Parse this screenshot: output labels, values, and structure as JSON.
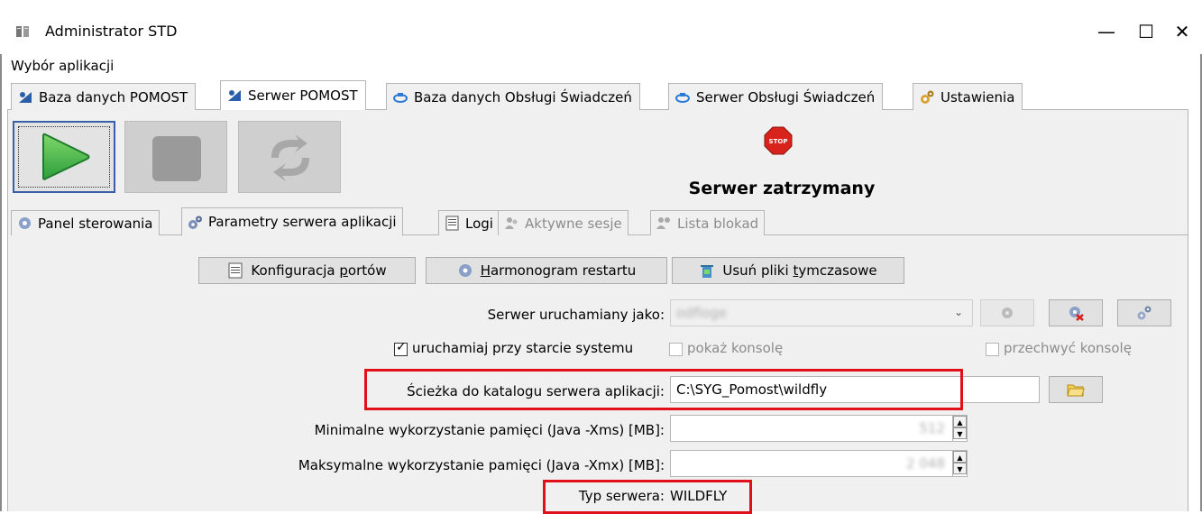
{
  "window": {
    "title": "Administrator STD",
    "minimize": "—",
    "maximize": "☐",
    "close": "✕",
    "icon": "server-app-icon"
  },
  "menu": {
    "app_label": "Wybór aplikacji"
  },
  "tabs_top": [
    {
      "label": "Baza danych POMOST",
      "icon": "pomost-icon"
    },
    {
      "label": "Serwer POMOST",
      "icon": "pomost-icon",
      "active": true
    },
    {
      "label": "Baza danych Obsługi Świadczeń",
      "icon": "service-icon"
    },
    {
      "label": "Serwer Obsługi Świadczeń",
      "icon": "service-icon"
    },
    {
      "label": "Ustawienia",
      "icon": "settings-icon"
    }
  ],
  "controls": {
    "start": "play-icon",
    "stop": "stop-square-icon",
    "restart": "restart-icon"
  },
  "status": {
    "text": "Serwer zatrzymany",
    "icon_label": "STOP"
  },
  "tabs_sub": [
    {
      "label": "Panel sterowania",
      "icon": "gear-icon"
    },
    {
      "label": "Parametry serwera aplikacji",
      "icon": "gears-icon",
      "active": true
    },
    {
      "label": "Logi",
      "icon": "log-icon"
    },
    {
      "label": "Aktywne sesje",
      "icon": "users-icon",
      "disabled": true
    },
    {
      "label": "Lista blokad",
      "icon": "lock-users-icon",
      "disabled": true
    }
  ],
  "buttons": {
    "ports_pre": "Konfiguracja ",
    "ports_u": "p",
    "ports_post": "ortów",
    "schedule_u": "H",
    "schedule_post": "armonogram restartu",
    "cleanup_pre": "Usuń pliki ",
    "cleanup_u": "t",
    "cleanup_post": "ymczasowe"
  },
  "form": {
    "run_as_label": "Serwer uruchamiany jako:",
    "run_as_value": "odfioge",
    "start_on_boot_label": "uruchamiaj przy starcie systemu",
    "start_on_boot_checked": true,
    "show_console_label": "pokaż konsolę",
    "capture_console_label": "przechwyć konsolę",
    "path_label": "Ścieżka do katalogu serwera aplikacji:",
    "path_value": "C:\\SYG_Pomost\\wildfly",
    "xms_label": "Minimalne wykorzystanie pamięci (Java -Xms) [MB]:",
    "xms_value": "512",
    "xmx_label": "Maksymalne wykorzystanie pamięci (Java -Xmx) [MB]:",
    "xmx_value": "2 048",
    "server_type_label": "Typ serwera:",
    "server_type_value": "WILDFLY"
  },
  "colors": {
    "highlight": "#e0101a",
    "play": "#3bb54a",
    "stop_sign": "#d8231c"
  }
}
